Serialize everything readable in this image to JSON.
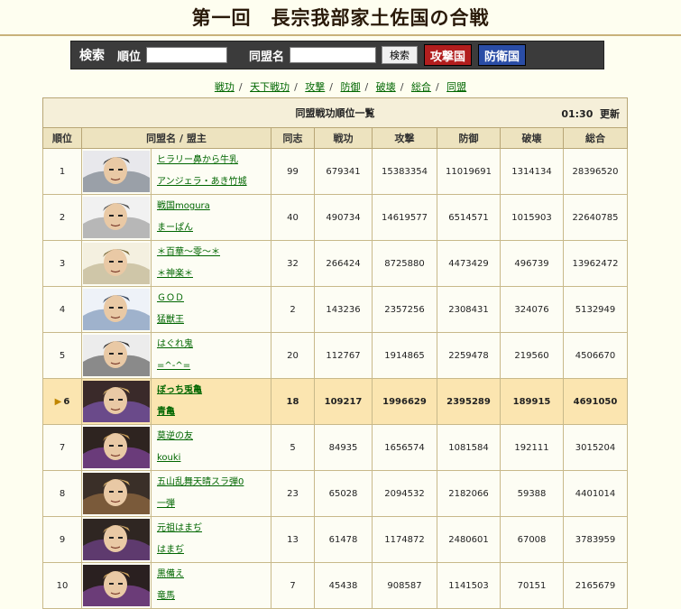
{
  "title": "第一回　長宗我部家土佐国の合戦",
  "search": {
    "label": "検索",
    "rank_label": "順位",
    "rank_value": "",
    "alliance_label": "同盟名",
    "alliance_value": "",
    "search_button": "検索",
    "attack_button": "攻撃国",
    "defense_button": "防衛国"
  },
  "nav": [
    "戦功",
    "天下戦功",
    "攻撃",
    "防御",
    "破壊",
    "総合",
    "同盟"
  ],
  "table": {
    "title": "同盟戦功順位一覧",
    "time": "01:30",
    "update_label": "更新",
    "headers": [
      "順位",
      "同盟名 / 盟主",
      "同志",
      "戦功",
      "攻撃",
      "防御",
      "破壊",
      "総合"
    ],
    "rows": [
      {
        "rank": "1",
        "alliance": "ヒラリー鼻から牛乳",
        "leader": "アンジェラ・あき竹城",
        "members": "99",
        "merit": "679341",
        "attack": "15383354",
        "defense": "11019691",
        "destroy": "1314134",
        "total": "28396520"
      },
      {
        "rank": "2",
        "alliance": "戦国mogura",
        "leader": "まーぱん",
        "members": "40",
        "merit": "490734",
        "attack": "14619577",
        "defense": "6514571",
        "destroy": "1015903",
        "total": "22640785"
      },
      {
        "rank": "3",
        "alliance": "＊百華～零～＊",
        "leader": "＊神楽＊",
        "members": "32",
        "merit": "266424",
        "attack": "8725880",
        "defense": "4473429",
        "destroy": "496739",
        "total": "13962472"
      },
      {
        "rank": "4",
        "alliance": "ＧＯＤ",
        "leader": "猛獣王",
        "members": "2",
        "merit": "143236",
        "attack": "2357256",
        "defense": "2308431",
        "destroy": "324076",
        "total": "5132949"
      },
      {
        "rank": "5",
        "alliance": "はぐれ鬼",
        "leader": "=^-^=",
        "members": "20",
        "merit": "112767",
        "attack": "1914865",
        "defense": "2259478",
        "destroy": "219560",
        "total": "4506670"
      },
      {
        "rank": "6",
        "alliance": "ぼっち兎亀",
        "leader": "青亀",
        "members": "18",
        "merit": "109217",
        "attack": "1996629",
        "defense": "2395289",
        "destroy": "189915",
        "total": "4691050"
      },
      {
        "rank": "7",
        "alliance": "莫逆の友",
        "leader": "kouki",
        "members": "5",
        "merit": "84935",
        "attack": "1656574",
        "defense": "1081584",
        "destroy": "192111",
        "total": "3015204"
      },
      {
        "rank": "8",
        "alliance": "五山乱舞天晴スラ弾0",
        "leader": "一弾",
        "members": "23",
        "merit": "65028",
        "attack": "2094532",
        "defense": "2182066",
        "destroy": "59388",
        "total": "4401014"
      },
      {
        "rank": "9",
        "alliance": "元祖はまぢ",
        "leader": "はまぢ",
        "members": "13",
        "merit": "61478",
        "attack": "1174872",
        "defense": "2480601",
        "destroy": "67008",
        "total": "3783959"
      },
      {
        "rank": "10",
        "alliance": "黒備え",
        "leader": "竜馬",
        "members": "7",
        "merit": "45438",
        "attack": "908587",
        "defense": "1141503",
        "destroy": "70151",
        "total": "2165679"
      }
    ]
  },
  "colors": {
    "accent_green": "#006600",
    "highlight_row": "#fbe5b0",
    "attack_red": "#b21e1e",
    "defense_blue": "#2a4da6"
  }
}
